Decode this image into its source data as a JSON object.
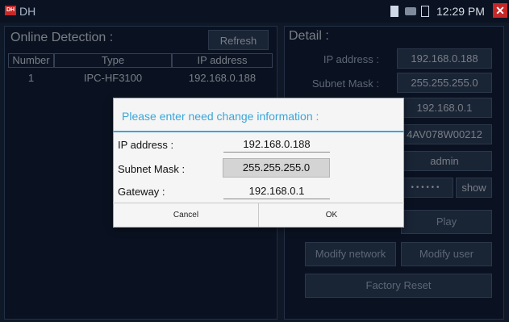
{
  "statusbar": {
    "app_icon_text": "DH",
    "app_title": "DH",
    "time": "12:29 PM",
    "close_icon": "close-icon"
  },
  "left": {
    "title": "Online Detection :",
    "refresh_label": "Refresh",
    "columns": [
      "Number",
      "Type",
      "IP address"
    ],
    "rows": [
      {
        "number": "1",
        "type": "IPC-HF3100",
        "ip": "192.168.0.188"
      }
    ]
  },
  "right": {
    "title": "Detail :",
    "fields": [
      {
        "label": "IP address :",
        "value": "192.168.0.188"
      },
      {
        "label": "Subnet Mask :",
        "value": "255.255.255.0"
      },
      {
        "label": "",
        "value": "192.168.0.1"
      },
      {
        "label": "",
        "value": "4AV078W00212"
      },
      {
        "label": "",
        "value": "admin"
      }
    ],
    "password_mask": "• • • • • •",
    "show_label": "show",
    "play_label": "Play",
    "modify_network_label": "Modify network",
    "modify_user_label": "Modify user",
    "factory_reset_label": "Factory Reset"
  },
  "dialog": {
    "title": "Please enter need change information :",
    "ip_label": "IP address :",
    "ip_value": "192.168.0.188",
    "mask_label": "Subnet Mask :",
    "mask_value": "255.255.255.0",
    "gateway_label": "Gateway :",
    "gateway_value": "192.168.0.1",
    "cancel_label": "Cancel",
    "ok_label": "OK",
    "accent_color": "#3aa6d8"
  }
}
